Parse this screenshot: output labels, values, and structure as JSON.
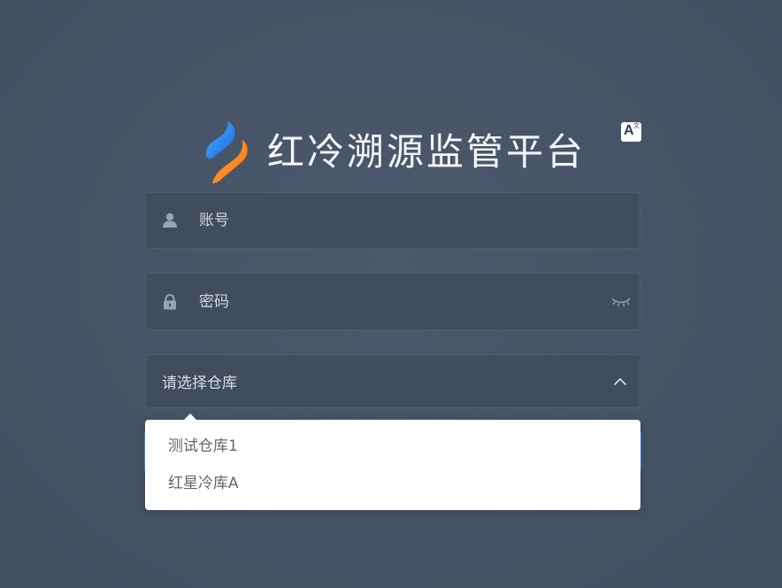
{
  "header": {
    "title": "红冷溯源监管平台",
    "logo_icon": "brand-logo-icon"
  },
  "lang_switch": {
    "icon": "translate-icon",
    "big": "A",
    "small": "文"
  },
  "form": {
    "account": {
      "placeholder": "账号",
      "value": "",
      "icon": "user-icon"
    },
    "password": {
      "placeholder": "密码",
      "value": "",
      "icon": "lock-icon",
      "toggle_icon": "eye-closed-icon"
    },
    "warehouse": {
      "placeholder": "请选择仓库",
      "icon": "chevron-up-icon",
      "expanded": true,
      "options": [
        {
          "label": "测试仓库1"
        },
        {
          "label": "红星冷库A"
        }
      ]
    }
  },
  "colors": {
    "background": "#485567",
    "field_bg": "#414c5c",
    "accent": "#3b8ee8",
    "logo_blue": "#1f8ef1",
    "logo_orange": "#ff8a1e"
  }
}
